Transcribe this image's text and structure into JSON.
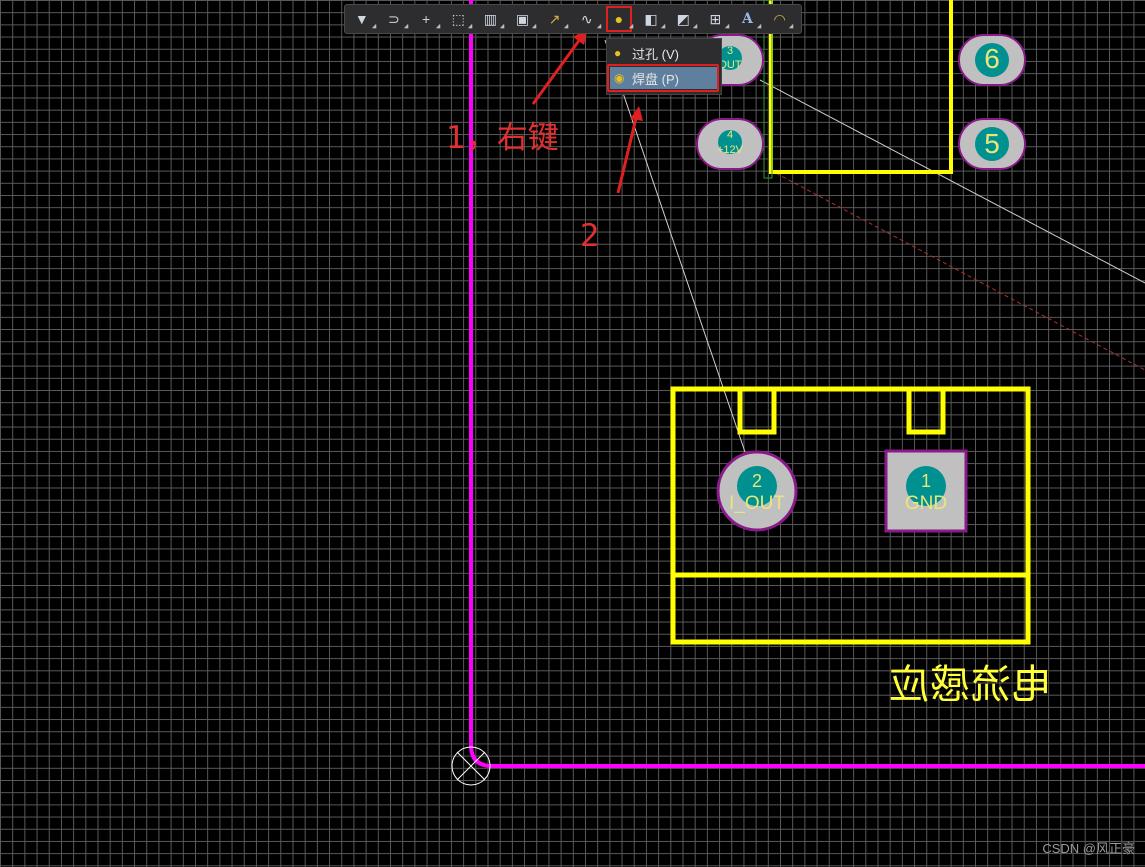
{
  "toolbar": {
    "buttons": [
      {
        "icon": "filter-icon",
        "glyph": "▼"
      },
      {
        "icon": "interactive-route-icon",
        "glyph": "⊃"
      },
      {
        "icon": "crosshair-icon",
        "glyph": "+"
      },
      {
        "icon": "select-area-icon",
        "glyph": "⬚"
      },
      {
        "icon": "align-icon",
        "glyph": "▥"
      },
      {
        "icon": "component-icon",
        "glyph": "▣"
      },
      {
        "icon": "route-icon",
        "glyph": "↗"
      },
      {
        "icon": "arc-route-icon",
        "glyph": "∿"
      },
      {
        "icon": "via-pad-icon",
        "glyph": "●"
      },
      {
        "icon": "fill-icon",
        "glyph": "◧"
      },
      {
        "icon": "polygon-icon",
        "glyph": "◩"
      },
      {
        "icon": "dimension-icon",
        "glyph": "⊞"
      },
      {
        "icon": "text-icon",
        "glyph": "A"
      },
      {
        "icon": "arc-icon",
        "glyph": "◠"
      }
    ]
  },
  "context_menu": {
    "items": [
      {
        "label": "过孔 (V)",
        "icon": "via-icon"
      },
      {
        "label": "焊盘 (P)",
        "icon": "pad-icon"
      }
    ]
  },
  "annotations": {
    "step1": "1，右键",
    "step2": "2"
  },
  "pads": {
    "p1": {
      "number": "1",
      "net": "GND"
    },
    "p2": {
      "number": "2",
      "net": "I_OUT"
    },
    "p3": {
      "number": "3",
      "net": "OUT"
    },
    "p4": {
      "number": "4",
      "net": "+12V"
    },
    "p5": {
      "number": "5"
    },
    "p6": {
      "number": "6"
    }
  },
  "component_label_mirrored": "电流感应",
  "watermark": "CSDN @风正豪",
  "colors": {
    "board_outline": "#ff00ff",
    "silkscreen": "#ffff00",
    "pad": "#c0c0c0",
    "pad_border": "#8a1a8a",
    "pad_center": "#009090",
    "annotation": "#e02020"
  }
}
